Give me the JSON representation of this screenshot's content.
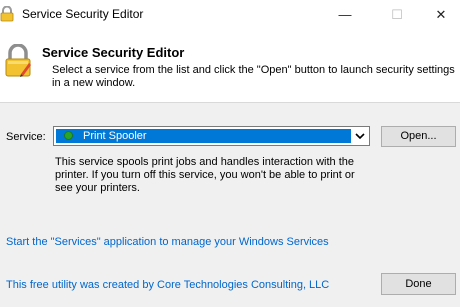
{
  "window": {
    "title": "Service Security Editor",
    "minimize": "—",
    "maximize": "☐",
    "close": "✕"
  },
  "header": {
    "title": "Service Security Editor",
    "description": "Select a service from the list and click the \"Open\" button to launch security settings in a new window.",
    "icon": "lock-icon"
  },
  "service": {
    "label": "Service:",
    "selected": "Print Spooler",
    "status_color": "#2aa52a",
    "open_label": "Open...",
    "description": "This service spools print jobs and handles interaction with the printer.  If you turn off this service, you won't be able to print or see your printers."
  },
  "footer": {
    "services_link": "Start the \"Services\" application to manage your Windows Services",
    "credit_link": "This free utility was created by Core Technologies Consulting, LLC",
    "done_label": "Done"
  },
  "colors": {
    "link": "#0066cc",
    "selection": "#0078d7"
  }
}
